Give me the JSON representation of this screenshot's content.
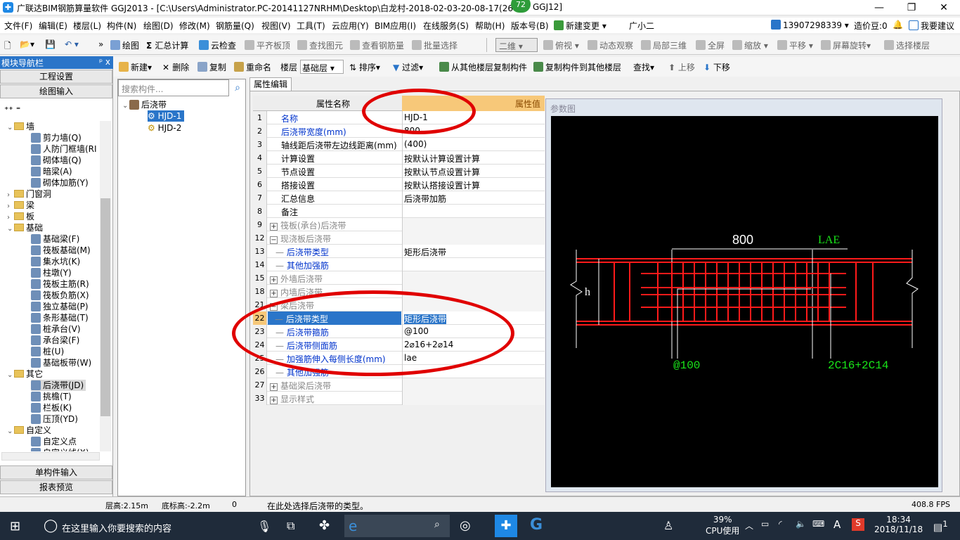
{
  "window": {
    "title": "广联达BIM钢筋算量软件 GGJ2013 - [C:\\Users\\Administrator.PC-20141127NRHM\\Desktop\\白龙村-2018-02-03-20-08-17(26",
    "title_tail": "GGJ12]",
    "badge": "72"
  },
  "menu": [
    "文件(F)",
    "编辑(E)",
    "楼层(L)",
    "构件(N)",
    "绘图(D)",
    "修改(M)",
    "钢筋量(Q)",
    "视图(V)",
    "工具(T)",
    "云应用(Y)",
    "BIM应用(I)",
    "在线服务(S)",
    "帮助(H)",
    "版本号(B)",
    "新建变更",
    "广小二"
  ],
  "account": {
    "phone": "13907298339",
    "beans": "造价豆:0",
    "suggest": "我要建议"
  },
  "toolbar": [
    "绘图",
    "汇总计算",
    "云检查",
    "平齐板顶",
    "查找图元",
    "查看钢筋量",
    "批量选择",
    "二维",
    "俯视",
    "动态观察",
    "局部三维",
    "全屏",
    "缩放",
    "平移",
    "屏幕旋转",
    "选择楼层"
  ],
  "nav": {
    "title": "模块导航栏",
    "pin": "ᵖ x",
    "eng_settings": "工程设置",
    "draw_input": "绘图输入",
    "single_input": "单构件输入",
    "report_preview": "报表预览"
  },
  "tree": [
    {
      "label": "墙",
      "type": "folder",
      "exp": "⌄"
    },
    {
      "label": "剪力墙(Q)",
      "type": "item"
    },
    {
      "label": "人防门框墙(RI",
      "type": "item"
    },
    {
      "label": "砌体墙(Q)",
      "type": "item"
    },
    {
      "label": "暗梁(A)",
      "type": "item"
    },
    {
      "label": "砌体加筋(Y)",
      "type": "item"
    },
    {
      "label": "门窗洞",
      "type": "folder",
      "exp": "›"
    },
    {
      "label": "梁",
      "type": "folder",
      "exp": "›"
    },
    {
      "label": "板",
      "type": "folder",
      "exp": "›"
    },
    {
      "label": "基础",
      "type": "folder",
      "exp": "⌄"
    },
    {
      "label": "基础梁(F)",
      "type": "item"
    },
    {
      "label": "筏板基础(M)",
      "type": "item"
    },
    {
      "label": "集水坑(K)",
      "type": "item"
    },
    {
      "label": "柱墩(Y)",
      "type": "item"
    },
    {
      "label": "筏板主筋(R)",
      "type": "item"
    },
    {
      "label": "筏板负筋(X)",
      "type": "item"
    },
    {
      "label": "独立基础(P)",
      "type": "item"
    },
    {
      "label": "条形基础(T)",
      "type": "item"
    },
    {
      "label": "桩承台(V)",
      "type": "item"
    },
    {
      "label": "承台梁(F)",
      "type": "item"
    },
    {
      "label": "桩(U)",
      "type": "item"
    },
    {
      "label": "基础板带(W)",
      "type": "item"
    },
    {
      "label": "其它",
      "type": "folder",
      "exp": "⌄"
    },
    {
      "label": "后浇带(JD)",
      "type": "item",
      "selected": true
    },
    {
      "label": "挑檐(T)",
      "type": "item"
    },
    {
      "label": "栏板(K)",
      "type": "item"
    },
    {
      "label": "压顶(YD)",
      "type": "item"
    },
    {
      "label": "自定义",
      "type": "folder",
      "exp": "⌄"
    },
    {
      "label": "自定义点",
      "type": "item"
    },
    {
      "label": "自定义线(X)",
      "type": "item"
    }
  ],
  "ctoolbar": [
    "新建",
    "删除",
    "复制",
    "重命名",
    "楼层",
    "基础层",
    "排序",
    "过滤",
    "从其他楼层复制构件",
    "复制构件到其他楼层",
    "查找",
    "上移",
    "下移"
  ],
  "components": {
    "search_placeholder": "搜索构件...",
    "root": "后浇带",
    "items": [
      "HJD-1",
      "HJD-2"
    ]
  },
  "props": {
    "tab": "属性编辑",
    "col_name": "属性名称",
    "col_value": "属性值",
    "rows": [
      {
        "n": "1",
        "name": "名称",
        "value": "HJD-1",
        "style": "blue"
      },
      {
        "n": "2",
        "name": "后浇带宽度(mm)",
        "value": "800",
        "style": "blue"
      },
      {
        "n": "3",
        "name": "轴线距后浇带左边线距离(mm)",
        "value": "(400)",
        "style": "black"
      },
      {
        "n": "4",
        "name": "计算设置",
        "value": "按默认计算设置计算",
        "style": "black"
      },
      {
        "n": "5",
        "name": "节点设置",
        "value": "按默认节点设置计算",
        "style": "black"
      },
      {
        "n": "6",
        "name": "搭接设置",
        "value": "按默认搭接设置计算",
        "style": "black"
      },
      {
        "n": "7",
        "name": "汇总信息",
        "value": "后浇带加筋",
        "style": "black"
      },
      {
        "n": "8",
        "name": "备注",
        "value": "",
        "style": "black"
      },
      {
        "n": "9",
        "name": "筏板(承台)后浇带",
        "value": "",
        "style": "gray",
        "plus": "+"
      },
      {
        "n": "12",
        "name": "现浇板后浇带",
        "value": "",
        "style": "gray",
        "plus": "−"
      },
      {
        "n": "13",
        "name": "后浇带类型",
        "value": "矩形后浇带",
        "style": "blue",
        "indent": true
      },
      {
        "n": "14",
        "name": "其他加强筋",
        "value": "",
        "style": "blue",
        "indent": true
      },
      {
        "n": "15",
        "name": "外墙后浇带",
        "value": "",
        "style": "gray",
        "plus": "+"
      },
      {
        "n": "18",
        "name": "内墙后浇带",
        "value": "",
        "style": "gray",
        "plus": "+"
      },
      {
        "n": "21",
        "name": "梁后浇带",
        "value": "",
        "style": "gray",
        "plus": "−"
      },
      {
        "n": "22",
        "name": "后浇带类型",
        "value": "矩形后浇带",
        "style": "selected",
        "indent": true
      },
      {
        "n": "23",
        "name": "后浇带箍筋",
        "value": "@100",
        "style": "blue",
        "indent": true
      },
      {
        "n": "24",
        "name": "后浇带侧面筋",
        "value": "2⌀16+2⌀14",
        "style": "blue",
        "indent": true
      },
      {
        "n": "25",
        "name": "加强筋伸入每侧长度(mm)",
        "value": "lae",
        "style": "blue",
        "indent": true
      },
      {
        "n": "26",
        "name": "其他加强筋",
        "value": "",
        "style": "blue",
        "indent": true
      },
      {
        "n": "27",
        "name": "基础梁后浇带",
        "value": "",
        "style": "gray",
        "plus": "+"
      },
      {
        "n": "33",
        "name": "显示样式",
        "value": "",
        "style": "gray",
        "plus": "+"
      }
    ]
  },
  "param": {
    "title": "参数图",
    "dim_width": "800",
    "dim_lae": "LAE",
    "label_h": "h",
    "stirrup": "@100",
    "side_bars": "2C16+2C14"
  },
  "status": {
    "floor_height": "层高:2.15m",
    "bottom_elev": "底标高:-2.2m",
    "zero": "0",
    "hint": "在此处选择后浇带的类型。",
    "fps": "408.8 FPS"
  },
  "taskbar": {
    "search": "在这里输入你要搜索的内容",
    "cpu_pct": "39%",
    "cpu_label": "CPU使用",
    "ime": "A",
    "time": "18:34",
    "date": "2018/11/18",
    "notif": "1"
  },
  "colors": {
    "accent": "#2a75c9",
    "annotation": "#e00000",
    "cad_red": "#ff1a1a",
    "cad_green": "#19e619"
  }
}
